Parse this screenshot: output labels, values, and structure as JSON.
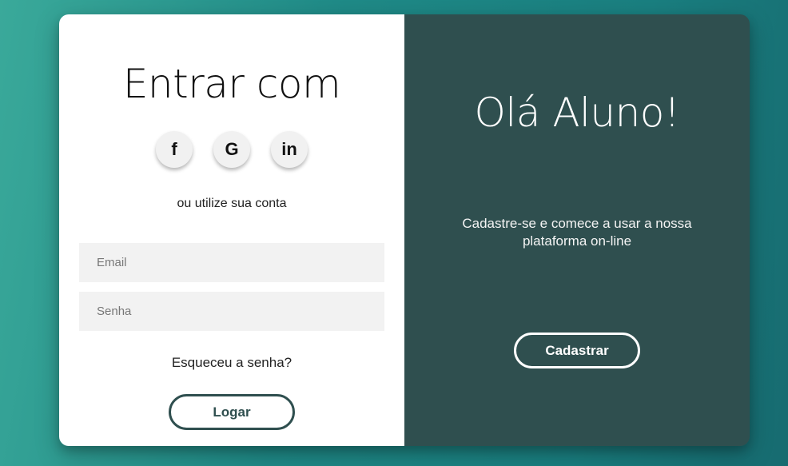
{
  "login": {
    "title": "Entrar com",
    "socials": [
      {
        "icon": "facebook-icon",
        "glyph": "f"
      },
      {
        "icon": "google-icon",
        "glyph": "G"
      },
      {
        "icon": "linkedin-icon",
        "glyph": "in"
      }
    ],
    "alt_text": "ou utilize sua conta",
    "email_placeholder": "Email",
    "password_placeholder": "Senha",
    "forgot_label": "Esqueceu a senha?",
    "submit_label": "Logar"
  },
  "signup": {
    "title": "Olá Aluno!",
    "description": "Cadastre-se e comece a usar a nossa plataforma on-line",
    "button_label": "Cadastrar"
  },
  "colors": {
    "panel_dark": "#2f4f4f",
    "background_start": "#3aa99a",
    "background_end": "#176b70",
    "input_bg": "#f2f2f2"
  }
}
